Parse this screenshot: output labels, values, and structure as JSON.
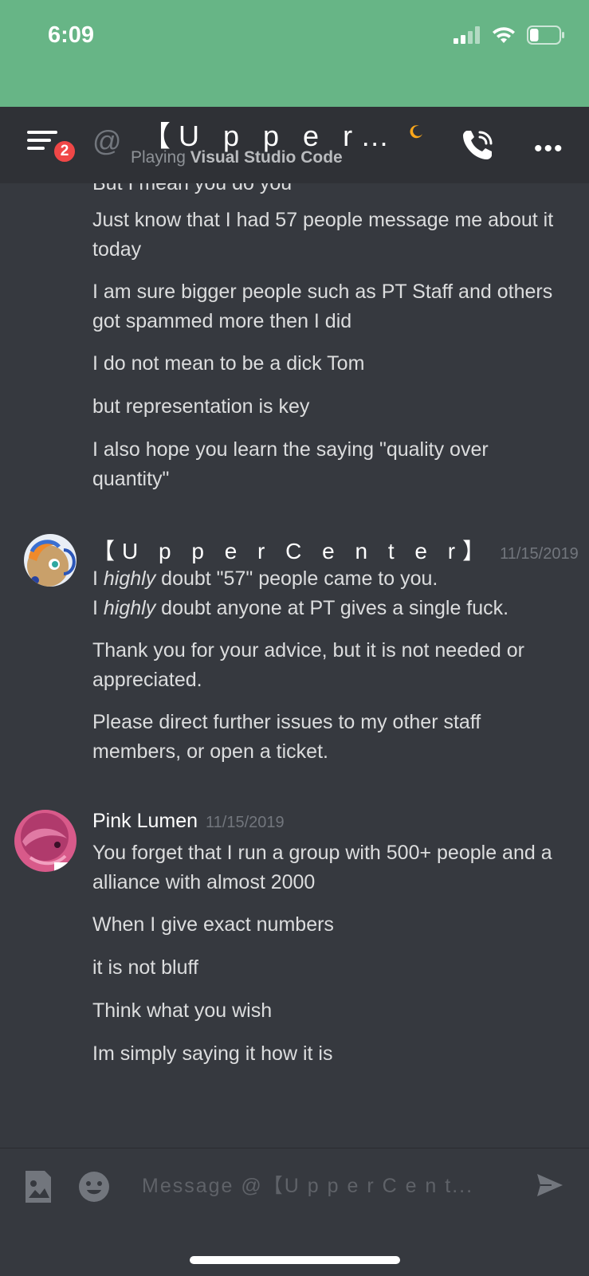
{
  "status_bar": {
    "time": "6:09",
    "battery_level": 0.3
  },
  "header": {
    "badge_count": "2",
    "at_symbol": "@",
    "title": "【U p p e r C e...",
    "subtitle_prefix": "Playing",
    "subtitle_app": "Visual Studio Code",
    "more": "•••"
  },
  "messages": {
    "cut_line": "But I mean you do you",
    "pink_block_1": [
      "Just know that I had 57 people message me about it today",
      "I am sure bigger people such as PT Staff and others got spammed more then I did",
      "I do not mean to be a dick Tom",
      "but representation is key",
      "I also hope you learn the saying \"quality over quantity\""
    ],
    "upper_group": {
      "author": "【U p p e r C e n t e r】",
      "timestamp": "11/15/2019",
      "msg1_l1_a": "I ",
      "msg1_l1_em": "highly",
      "msg1_l1_b": " doubt \"57\" people came  to you.",
      "msg1_l2_a": "I ",
      "msg1_l2_em": "highly",
      "msg1_l2_b": " doubt anyone at PT gives a single fuck.",
      "msg2": "Thank you for your advice, but it is not needed or appreciated.",
      "msg3": "Please direct further issues to my other staff members, or open a ticket."
    },
    "pink_group": {
      "author": "Pink Lumen",
      "timestamp": "11/15/2019",
      "lines": [
        "You forget that I run a group with 500+ people and a alliance with almost 2000",
        "When I give exact numbers",
        "it is not bluff",
        "Think what you wish",
        "Im simply saying it how it is"
      ]
    }
  },
  "composer": {
    "placeholder": "Message @【U p p e r C e n t..."
  },
  "colors": {
    "accent_green": "#67b586",
    "bg": "#36393f",
    "header_bg": "#2f3136",
    "badge_red": "#f04747",
    "moon": "#faa61a"
  },
  "icons": [
    "menu-icon",
    "at-icon",
    "moon-icon",
    "call-icon",
    "more-icon",
    "image-icon",
    "emoji-icon",
    "send-icon",
    "signal-icon",
    "wifi-icon",
    "battery-icon"
  ]
}
